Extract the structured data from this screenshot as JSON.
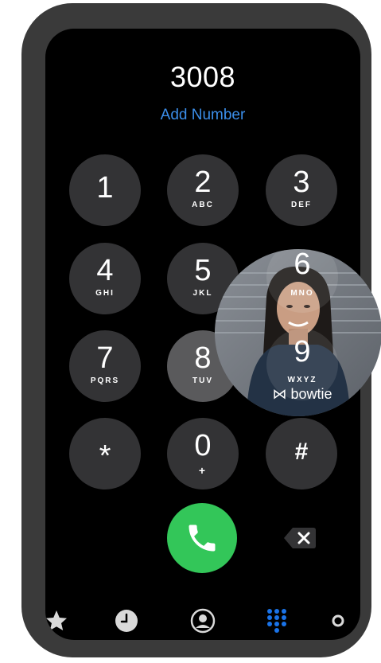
{
  "dialer": {
    "number": "3008",
    "add_number_label": "Add Number"
  },
  "keypad": {
    "keys": [
      {
        "digit": "1",
        "letters": ""
      },
      {
        "digit": "2",
        "letters": "ABC"
      },
      {
        "digit": "3",
        "letters": "DEF"
      },
      {
        "digit": "4",
        "letters": "GHI"
      },
      {
        "digit": "5",
        "letters": "JKL"
      },
      {
        "digit": "6",
        "letters": "MNO"
      },
      {
        "digit": "7",
        "letters": "PQRS"
      },
      {
        "digit": "8",
        "letters": "TUV"
      },
      {
        "digit": "9",
        "letters": "WXYZ"
      },
      {
        "digit": "*",
        "letters": ""
      },
      {
        "digit": "0",
        "letters": "+"
      },
      {
        "digit": "#",
        "letters": ""
      }
    ]
  },
  "actions": {
    "call_icon": "phone-icon",
    "delete_icon": "backspace-icon"
  },
  "tabbar": {
    "tabs": [
      {
        "icon": "star-icon"
      },
      {
        "icon": "clock-icon"
      },
      {
        "icon": "contact-icon"
      },
      {
        "icon": "keypad-icon",
        "active": true
      },
      {
        "icon": "voicemail-icon"
      }
    ]
  },
  "overlay": {
    "brand_text": "bowtie"
  },
  "colors": {
    "frame": "#3a3a3a",
    "screen": "#000000",
    "key": "#333335",
    "link": "#3b8eea",
    "call": "#33c659",
    "tab_active": "#1a73e8",
    "tab_inactive": "#d9d9d9"
  }
}
